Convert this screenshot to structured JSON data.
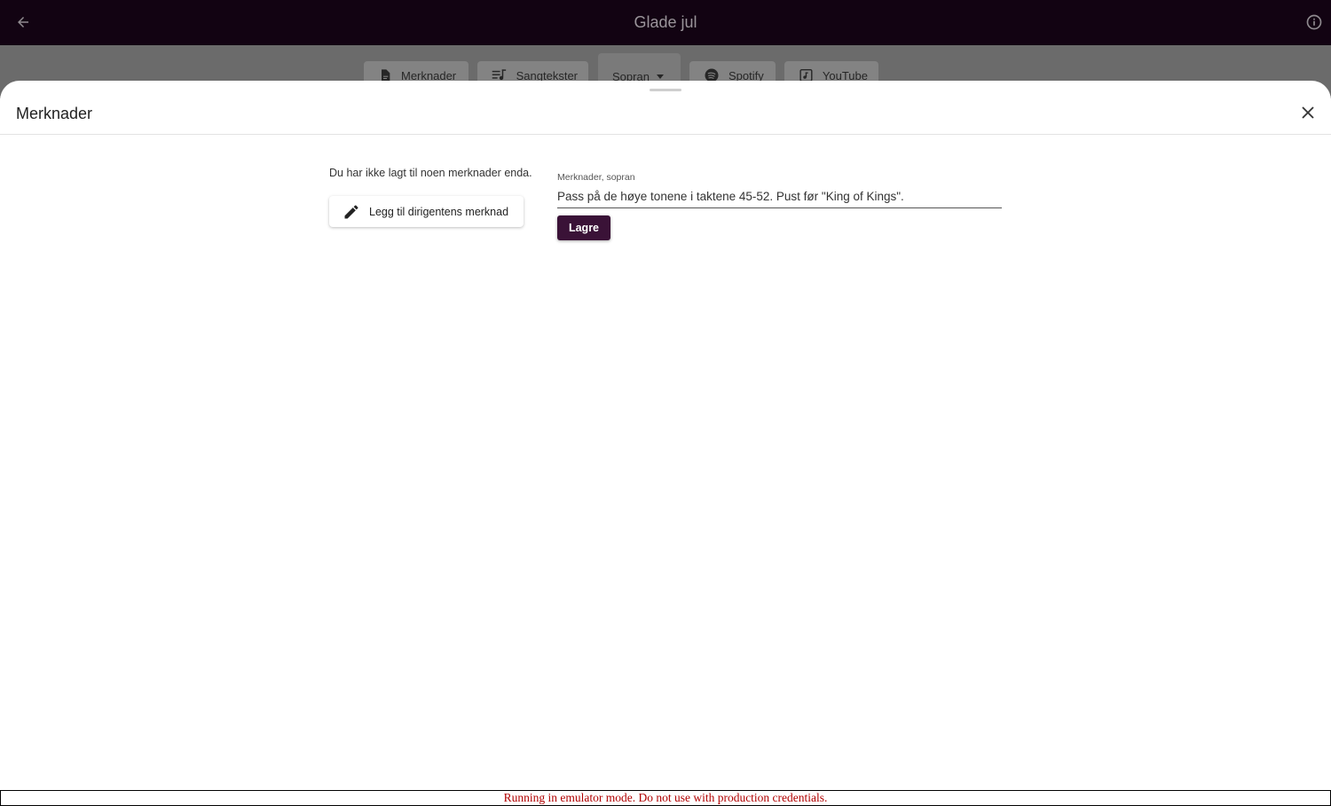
{
  "app_bar": {
    "title": "Glade jul",
    "back_icon": "arrow-left-icon",
    "info_icon": "info-icon"
  },
  "tabs": [
    {
      "label": "Merknader",
      "icon": "file-icon"
    },
    {
      "label": "Sangtekster",
      "icon": "lyrics-icon"
    },
    {
      "label": "Sopran",
      "icon": "chevron-down-icon"
    },
    {
      "label": "Spotify",
      "icon": "spotify-icon"
    },
    {
      "label": "YouTube",
      "icon": "music-note-icon"
    }
  ],
  "sheet": {
    "title": "Merknader",
    "close_icon": "close-icon",
    "empty_message": "Du har ikke lagt til noen merknader enda.",
    "add_button_label": "Legg til dirigentens merknad",
    "add_button_icon": "pencil-icon",
    "note_field": {
      "label": "Merknader, sopran",
      "value": "Pass på de høye tonene i taktene 45-52. Pust før \"King of Kings\"."
    },
    "save_label": "Lagre"
  },
  "emulator_banner": "Running in emulator mode. Do not use with production credentials.",
  "colors": {
    "app_bar_bg": "#120312",
    "primary": "#3a1237",
    "banner_text": "#b00000"
  }
}
